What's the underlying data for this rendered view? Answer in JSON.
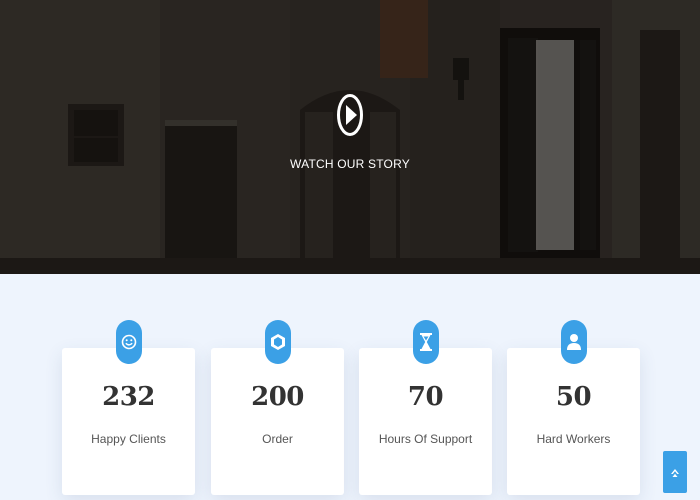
{
  "hero": {
    "watch_label": "WATCH OUR STORY",
    "play_icon": "play-circle-icon"
  },
  "stats": {
    "items": [
      {
        "value": "232",
        "label": "Happy Clients",
        "icon": "smiley-icon"
      },
      {
        "value": "200",
        "label": "Order",
        "icon": "gem-icon"
      },
      {
        "value": "70",
        "label": "Hours Of Support",
        "icon": "hourglass-icon"
      },
      {
        "value": "50",
        "label": "Hard Workers",
        "icon": "user-icon"
      }
    ]
  },
  "scroll_top": {
    "icon": "chevron-up-icon"
  },
  "colors": {
    "accent": "#3ba0e6",
    "section_bg": "#eef4fd",
    "card_bg": "#ffffff",
    "number": "#333333",
    "label": "#555555"
  }
}
